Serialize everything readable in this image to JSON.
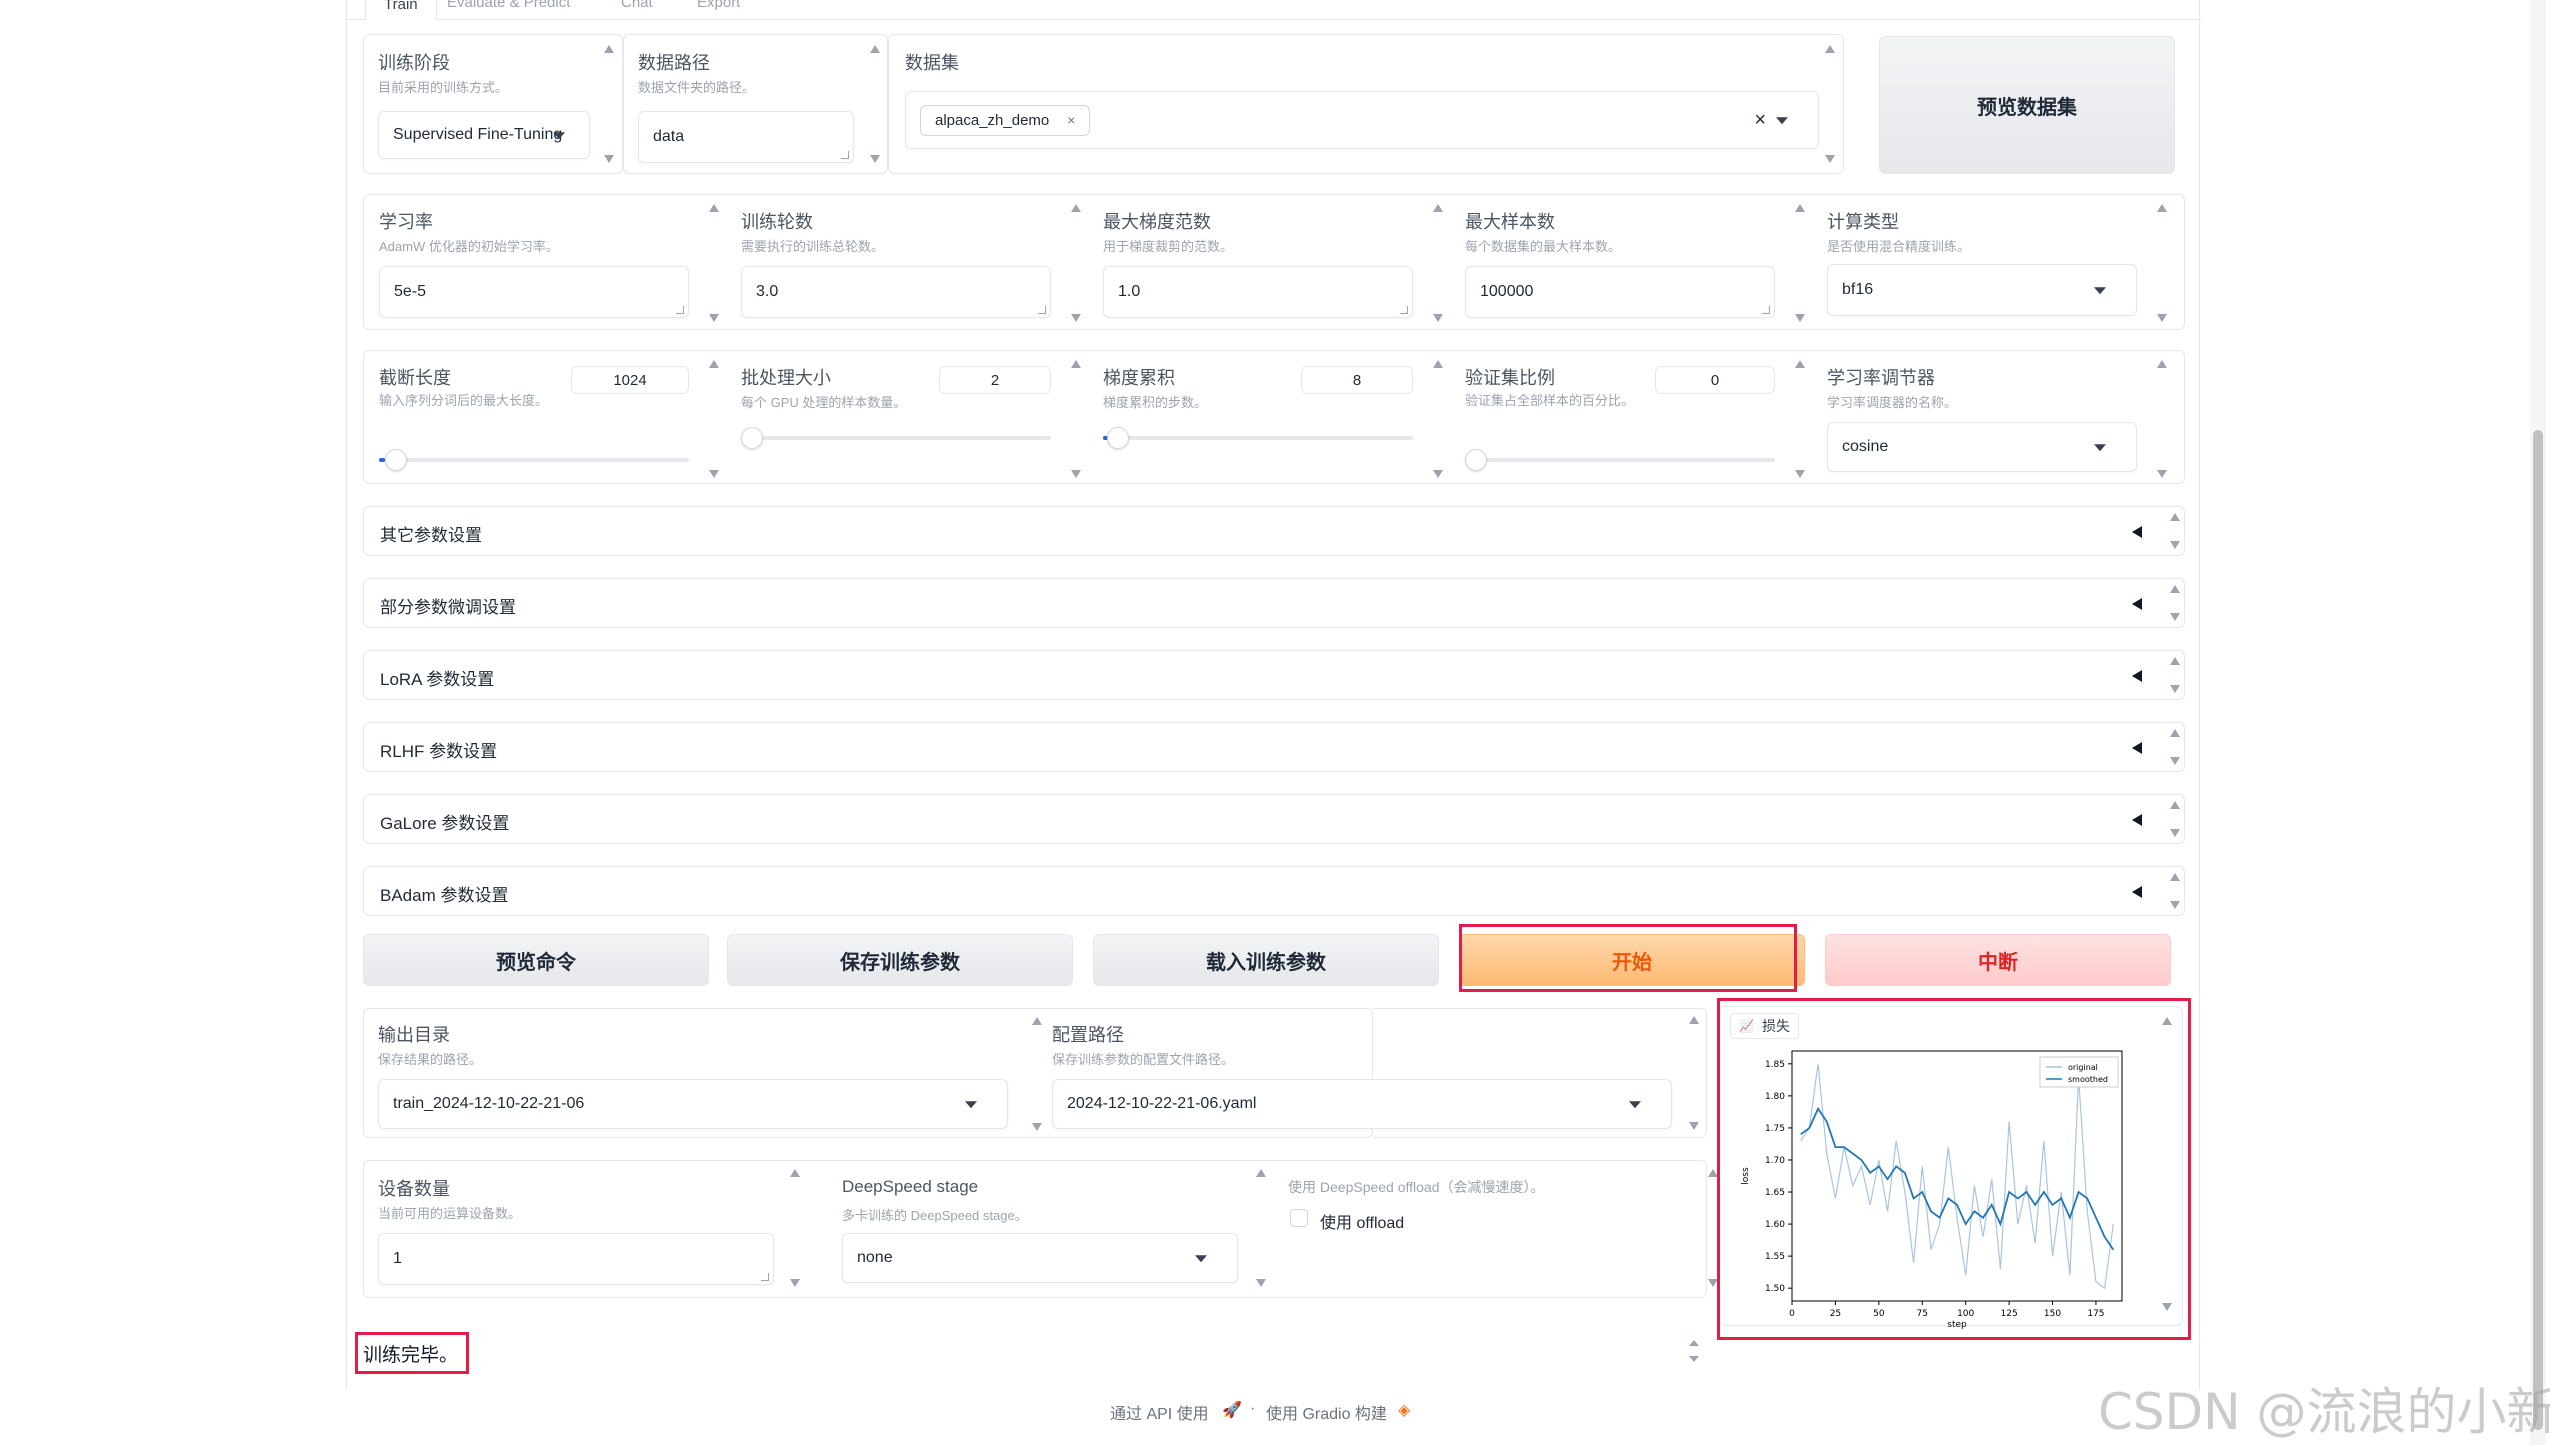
{
  "tabs": [
    "Train",
    "Evaluate & Predict",
    "Chat",
    "Export"
  ],
  "row1": {
    "stage": {
      "title": "训练阶段",
      "info": "目前采用的训练方式。",
      "value": "Supervised Fine-Tuning"
    },
    "dataset_dir": {
      "title": "数据路径",
      "info": "数据文件夹的路径。",
      "value": "data"
    },
    "dataset": {
      "title": "数据集",
      "chip": "alpaca_zh_demo",
      "chip_close": "×",
      "clear": "×"
    },
    "preview_dataset": "预览数据集"
  },
  "row2": {
    "learning_rate": {
      "title": "学习率",
      "info": "AdamW 优化器的初始学习率。",
      "value": "5e-5"
    },
    "num_epochs": {
      "title": "训练轮数",
      "info": "需要执行的训练总轮数。",
      "value": "3.0"
    },
    "max_grad_norm": {
      "title": "最大梯度范数",
      "info": "用于梯度裁剪的范数。",
      "value": "1.0"
    },
    "max_samples": {
      "title": "最大样本数",
      "info": "每个数据集的最大样本数。",
      "value": "100000"
    },
    "compute_type": {
      "title": "计算类型",
      "info": "是否使用混合精度训练。",
      "value": "bf16"
    }
  },
  "row3": {
    "cutoff_len": {
      "title": "截断长度",
      "info": "输入序列分词后的最大长度。",
      "value": "1024",
      "level": 0.02
    },
    "batch_size": {
      "title": "批处理大小",
      "info": "每个 GPU 处理的样本数量。",
      "value": "2",
      "level": 0.0
    },
    "grad_accum": {
      "title": "梯度累积",
      "info": "梯度累积的步数。",
      "value": "8",
      "level": 0.03
    },
    "val_size": {
      "title": "验证集比例",
      "info": "验证集占全部样本的百分比。",
      "value": "0",
      "level": 0.0
    },
    "lr_scheduler": {
      "title": "学习率调节器",
      "info": "学习率调度器的名称。",
      "value": "cosine"
    }
  },
  "accordions": [
    "其它参数设置",
    "部分参数微调设置",
    "LoRA 参数设置",
    "RLHF 参数设置",
    "GaLore 参数设置",
    "BAdam 参数设置"
  ],
  "buttons": {
    "preview_cmd": "预览命令",
    "save_args": "保存训练参数",
    "load_args": "载入训练参数",
    "start": "开始",
    "stop": "中断"
  },
  "output": {
    "output_dir": {
      "title": "输出目录",
      "info": "保存结果的路径。",
      "value": "train_2024-12-10-22-21-06"
    },
    "config_path": {
      "title": "配置路径",
      "info": "保存训练参数的配置文件路径。",
      "value": "2024-12-10-22-21-06.yaml"
    },
    "device_count": {
      "title": "设备数量",
      "info": "当前可用的运算设备数。",
      "value": "1"
    },
    "ds_stage": {
      "title": "DeepSpeed stage",
      "info": "多卡训练的 DeepSpeed stage。",
      "value": "none"
    },
    "ds_offload": {
      "title": "使用 DeepSpeed offload（会减慢速度）。",
      "label": "使用 offload"
    }
  },
  "status": "训练完毕。",
  "plot_label": "损失",
  "chart_data": {
    "type": "line",
    "xlabel": "step",
    "ylabel": "loss",
    "xlim": [
      0,
      190
    ],
    "ylim": [
      1.48,
      1.87
    ],
    "xticks": [
      0,
      25,
      50,
      75,
      100,
      125,
      150,
      175
    ],
    "yticks": [
      "1.50",
      "1.55",
      "1.60",
      "1.65",
      "1.70",
      "1.75",
      "1.80",
      "1.85"
    ],
    "x": [
      5,
      10,
      15,
      20,
      25,
      30,
      35,
      40,
      45,
      50,
      55,
      60,
      65,
      70,
      75,
      80,
      85,
      90,
      95,
      100,
      105,
      110,
      115,
      120,
      125,
      130,
      135,
      140,
      145,
      150,
      155,
      160,
      165,
      170,
      175,
      180,
      185
    ],
    "series": [
      {
        "name": "original",
        "values": [
          1.73,
          1.75,
          1.85,
          1.71,
          1.64,
          1.72,
          1.66,
          1.69,
          1.63,
          1.7,
          1.62,
          1.73,
          1.65,
          1.54,
          1.69,
          1.56,
          1.6,
          1.72,
          1.61,
          1.52,
          1.66,
          1.58,
          1.67,
          1.53,
          1.76,
          1.6,
          1.66,
          1.57,
          1.73,
          1.55,
          1.65,
          1.52,
          1.83,
          1.62,
          1.51,
          1.5,
          1.6
        ]
      },
      {
        "name": "smoothed",
        "values": [
          1.74,
          1.75,
          1.78,
          1.76,
          1.72,
          1.72,
          1.71,
          1.7,
          1.68,
          1.69,
          1.67,
          1.69,
          1.68,
          1.64,
          1.65,
          1.62,
          1.61,
          1.64,
          1.63,
          1.6,
          1.62,
          1.61,
          1.63,
          1.6,
          1.65,
          1.64,
          1.65,
          1.63,
          1.65,
          1.63,
          1.64,
          1.61,
          1.65,
          1.64,
          1.61,
          1.58,
          1.56
        ]
      }
    ],
    "legend": "top-right",
    "colors": {
      "original": "#a9c4e0",
      "smoothed": "#1f77b4"
    }
  },
  "footer": {
    "api": "通过 API 使用",
    "sep": "·",
    "gradio": "使用 Gradio 构建"
  },
  "watermark": "CSDN @流浪的小新",
  "colors": {
    "highlight": "#e11d48",
    "start_text": "#ea580c",
    "stop_text": "#dc2626"
  }
}
